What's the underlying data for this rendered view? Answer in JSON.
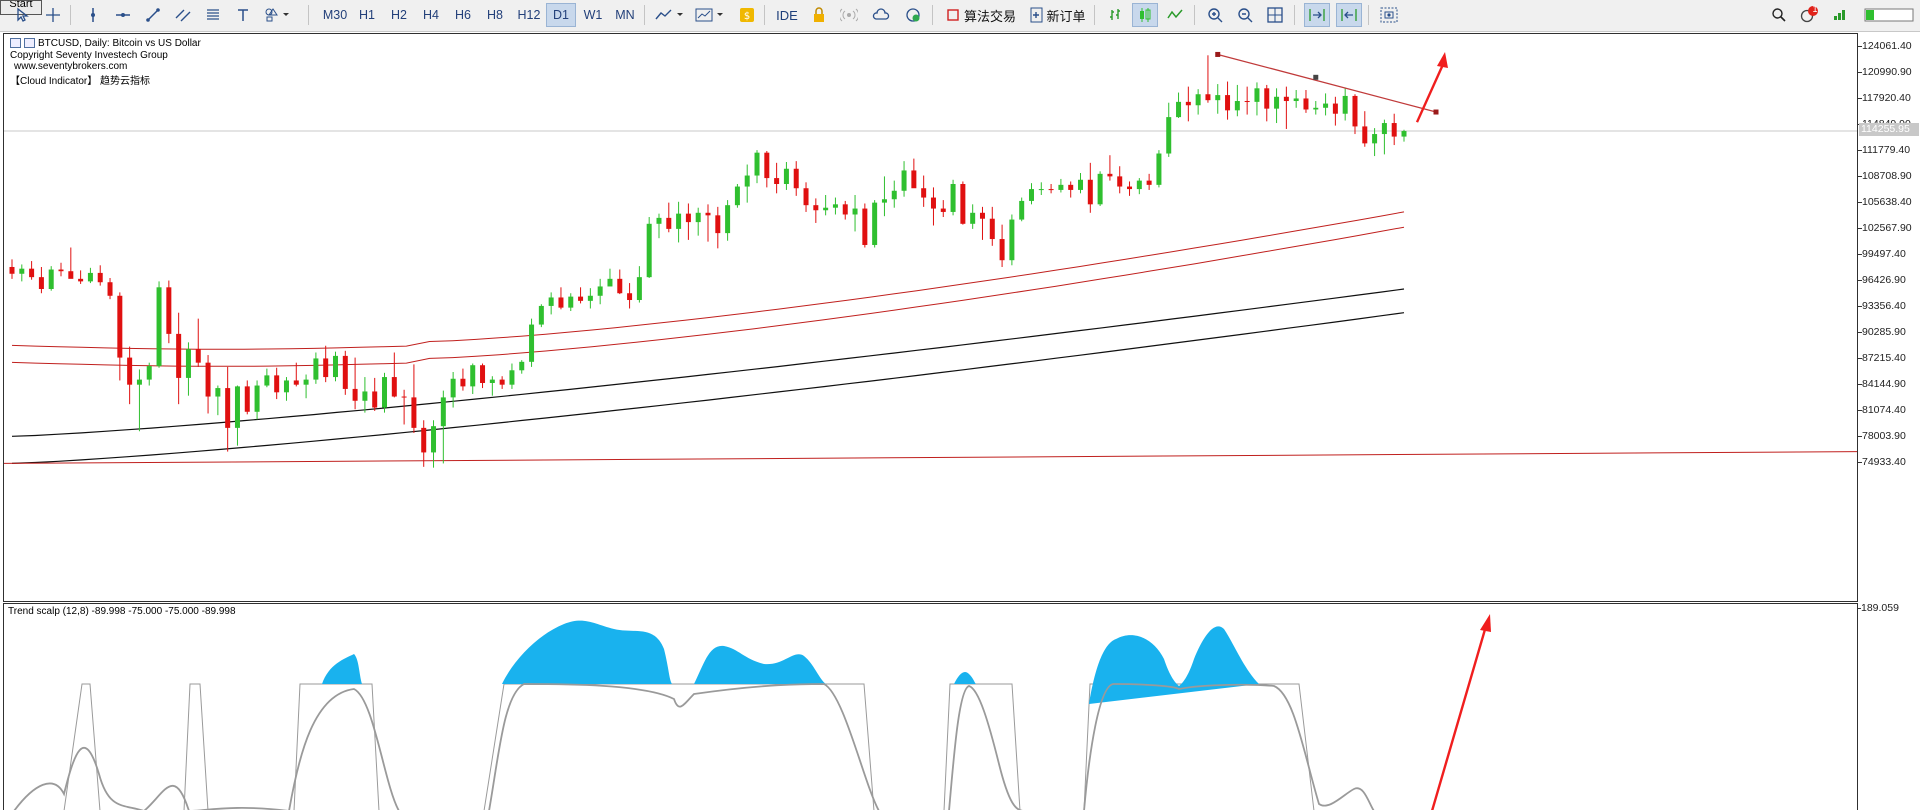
{
  "toolbar": {
    "start_label": "Start",
    "timeframes": [
      "M30",
      "H1",
      "H2",
      "H4",
      "H6",
      "H8",
      "H12",
      "D1",
      "W1",
      "MN"
    ],
    "active_timeframe": "D1",
    "ide_label": "IDE",
    "algo_trading_label": "算法交易",
    "new_order_label": "新订单",
    "notification_count": "1",
    "icons": [
      "cursor-icon",
      "crosshair-icon",
      "vertical-line-icon",
      "horizontal-line-icon",
      "trendline-icon",
      "channel-icon",
      "fibonacci-icon",
      "text-icon",
      "shapes-icon",
      "indicator-icon",
      "template-icon",
      "market-icon",
      "lock-icon",
      "signal-icon",
      "cloud-icon",
      "vps-icon",
      "algo-icon",
      "new-order-icon",
      "bar-chart-icon",
      "candle-chart-icon",
      "line-chart-icon",
      "zoom-in-icon",
      "zoom-out-icon",
      "grid-icon",
      "autoscroll-icon",
      "chart-shift-icon",
      "screenshot-icon",
      "search-icon",
      "notification-icon",
      "signal-strength-icon"
    ]
  },
  "chart": {
    "symbol_line": "BTCUSD, Daily:  Bitcoin vs US Dollar",
    "copyright": "Copyright Seventy Investech Group",
    "website": "www.seventybrokers.com",
    "indicator_name": "【Cloud Indicator】 趋势云指标",
    "price_ticks": [
      "124061.40",
      "120990.90",
      "117920.40",
      "114849.90",
      "111779.40",
      "108708.90",
      "105638.40",
      "102567.90",
      "99497.40",
      "96426.90",
      "93356.40",
      "90285.90",
      "87215.40",
      "84144.90",
      "81074.40",
      "78003.90",
      "74933.40"
    ],
    "current_price": "114255.95",
    "current_price_value": 114255.95
  },
  "indicator": {
    "label": "Trend scalp (12,8) -89.998 -75.000 -75.000 -89.998",
    "top_value": "189.059"
  },
  "colors": {
    "bull": "#2fbf2f",
    "bear": "#e01010",
    "red_band": "#c0201e",
    "black_band": "#101010",
    "cloud": "#19b2ee",
    "osc_gray": "#9a9a9a",
    "arrow": "#f01e1e",
    "toolbar_bg": "#f0f0f0"
  },
  "chart_data": {
    "type": "candlestick",
    "series_type": "ohlc",
    "price_range": [
      73500,
      125500
    ],
    "candles": [
      [
        98200,
        99100,
        96800,
        97400
      ],
      [
        97400,
        98500,
        96500,
        98000
      ],
      [
        98000,
        98900,
        96700,
        97000
      ],
      [
        97000,
        98200,
        95100,
        95600
      ],
      [
        95600,
        98300,
        95400,
        97900
      ],
      [
        97900,
        98700,
        97100,
        97700
      ],
      [
        97700,
        100500,
        97400,
        96800
      ],
      [
        96800,
        97800,
        96200,
        96500
      ],
      [
        96500,
        98100,
        96300,
        97500
      ],
      [
        97500,
        98400,
        96000,
        96400
      ],
      [
        96400,
        96900,
        94400,
        94800
      ],
      [
        94800,
        95200,
        84800,
        87500
      ],
      [
        87500,
        88800,
        82000,
        84300
      ],
      [
        84300,
        86100,
        78800,
        84900
      ],
      [
        84900,
        86900,
        84200,
        86500
      ],
      [
        86500,
        96500,
        86300,
        95800
      ],
      [
        95800,
        96600,
        89200,
        90300
      ],
      [
        90300,
        92800,
        82000,
        85100
      ],
      [
        85100,
        89300,
        83000,
        88500
      ],
      [
        88500,
        92100,
        86400,
        86900
      ],
      [
        86900,
        87800,
        80900,
        82900
      ],
      [
        82900,
        84200,
        80700,
        83900
      ],
      [
        83900,
        86400,
        76400,
        79200
      ],
      [
        79200,
        84200,
        77100,
        84100
      ],
      [
        84100,
        84800,
        80800,
        81100
      ],
      [
        81100,
        84800,
        80200,
        84200
      ],
      [
        84200,
        86200,
        84000,
        85400
      ],
      [
        85400,
        86300,
        82600,
        83400
      ],
      [
        83400,
        85200,
        82400,
        84800
      ],
      [
        84800,
        86900,
        84100,
        84300
      ],
      [
        84300,
        85500,
        82700,
        84900
      ],
      [
        84900,
        88100,
        84400,
        87400
      ],
      [
        87400,
        88900,
        84600,
        85200
      ],
      [
        85200,
        88200,
        84700,
        87700
      ],
      [
        87700,
        88300,
        83100,
        83800
      ],
      [
        83800,
        87500,
        81400,
        82400
      ],
      [
        82400,
        85200,
        81000,
        83500
      ],
      [
        83500,
        85100,
        81200,
        81600
      ],
      [
        81600,
        85700,
        81000,
        85200
      ],
      [
        85200,
        88100,
        82800,
        82900
      ],
      [
        82900,
        83700,
        79600,
        82800
      ],
      [
        82800,
        86700,
        78600,
        79200
      ],
      [
        79200,
        80100,
        74600,
        76300
      ],
      [
        76300,
        80100,
        74500,
        79400
      ],
      [
        79400,
        83600,
        75000,
        82800
      ],
      [
        82800,
        85800,
        81600,
        85000
      ],
      [
        85000,
        86200,
        83600,
        84100
      ],
      [
        84100,
        86800,
        83200,
        86600
      ],
      [
        86600,
        86800,
        83900,
        84500
      ],
      [
        84500,
        85300,
        83000,
        84900
      ],
      [
        84900,
        85300,
        83800,
        84300
      ],
      [
        84300,
        86800,
        83800,
        86000
      ],
      [
        86000,
        87200,
        85600,
        87000
      ],
      [
        87000,
        92100,
        86400,
        91400
      ],
      [
        91400,
        93800,
        91100,
        93600
      ],
      [
        93600,
        95200,
        92600,
        94600
      ],
      [
        94600,
        95800,
        93200,
        93400
      ],
      [
        93400,
        95100,
        93000,
        94700
      ],
      [
        94700,
        95800,
        93900,
        94200
      ],
      [
        94200,
        95700,
        93300,
        94800
      ],
      [
        94800,
        96800,
        93800,
        95900
      ],
      [
        95900,
        98000,
        96300,
        96800
      ],
      [
        96800,
        97900,
        95000,
        95100
      ],
      [
        95100,
        96300,
        93300,
        94300
      ],
      [
        94300,
        98300,
        94000,
        97000
      ],
      [
        97000,
        104100,
        96900,
        103300
      ],
      [
        103300,
        104500,
        101600,
        104000
      ],
      [
        104000,
        105800,
        102300,
        102700
      ],
      [
        102700,
        105900,
        101100,
        104500
      ],
      [
        104500,
        105700,
        101400,
        103500
      ],
      [
        103500,
        105200,
        101900,
        104600
      ],
      [
        104600,
        105600,
        101200,
        104300
      ],
      [
        104300,
        105300,
        100400,
        102200
      ],
      [
        102200,
        106100,
        101300,
        105500
      ],
      [
        105500,
        108000,
        105200,
        107700
      ],
      [
        107700,
        110300,
        105800,
        109000
      ],
      [
        109000,
        112000,
        108100,
        111700
      ],
      [
        111700,
        111900,
        107600,
        108700
      ],
      [
        108700,
        110500,
        106900,
        108000
      ],
      [
        108000,
        110600,
        107300,
        109800
      ],
      [
        109800,
        110700,
        106600,
        107500
      ],
      [
        107500,
        108200,
        104700,
        105500
      ],
      [
        105500,
        106300,
        103400,
        104900
      ],
      [
        104900,
        106700,
        104300,
        105200
      ],
      [
        105200,
        106400,
        104400,
        105600
      ],
      [
        105600,
        106000,
        103800,
        104400
      ],
      [
        104400,
        106700,
        102400,
        105100
      ],
      [
        105100,
        105700,
        100500,
        100800
      ],
      [
        100800,
        106100,
        100500,
        105800
      ],
      [
        105800,
        108900,
        104200,
        106200
      ],
      [
        106200,
        108400,
        105200,
        107200
      ],
      [
        107200,
        110700,
        106500,
        109600
      ],
      [
        109600,
        111000,
        107600,
        107500
      ],
      [
        107500,
        109000,
        105300,
        106400
      ],
      [
        106400,
        107600,
        103100,
        105100
      ],
      [
        105100,
        106100,
        104100,
        104700
      ],
      [
        104700,
        108500,
        104300,
        108000
      ],
      [
        108000,
        108300,
        103200,
        103300
      ],
      [
        103300,
        105600,
        102700,
        104600
      ],
      [
        104600,
        105300,
        101400,
        103900
      ],
      [
        103900,
        105300,
        100700,
        101500
      ],
      [
        101500,
        103200,
        98200,
        99000
      ],
      [
        99000,
        104400,
        98400,
        103800
      ],
      [
        103800,
        106400,
        103600,
        106000
      ],
      [
        106000,
        108100,
        105600,
        107400
      ],
      [
        107400,
        108200,
        106700,
        107400
      ],
      [
        107400,
        108000,
        106900,
        107300
      ],
      [
        107300,
        108600,
        107000,
        107900
      ],
      [
        107900,
        108300,
        106400,
        107300
      ],
      [
        107300,
        109300,
        106900,
        108500
      ],
      [
        108500,
        110500,
        104600,
        105600
      ],
      [
        105600,
        109500,
        105400,
        109200
      ],
      [
        109200,
        111400,
        108400,
        108900
      ],
      [
        108900,
        110100,
        106900,
        107700
      ],
      [
        107700,
        108300,
        106600,
        107400
      ],
      [
        107400,
        108700,
        106800,
        108400
      ],
      [
        108400,
        109200,
        107300,
        107900
      ],
      [
        107900,
        112000,
        107600,
        111600
      ],
      [
        111600,
        117600,
        111200,
        115900
      ],
      [
        115900,
        118800,
        115800,
        117700
      ],
      [
        117700,
        119500,
        115400,
        117300
      ],
      [
        117300,
        119200,
        116200,
        118600
      ],
      [
        118600,
        123200,
        117600,
        117900
      ],
      [
        117900,
        119800,
        116300,
        118500
      ],
      [
        118500,
        120100,
        115600,
        116700
      ],
      [
        116700,
        119700,
        116000,
        117800
      ],
      [
        117800,
        119500,
        116200,
        117700
      ],
      [
        117700,
        120000,
        116100,
        119300
      ],
      [
        119300,
        119700,
        115400,
        116900
      ],
      [
        116900,
        119300,
        115200,
        118300
      ],
      [
        118300,
        119500,
        114500,
        117800
      ],
      [
        117800,
        119100,
        117000,
        118100
      ],
      [
        118100,
        119100,
        116400,
        116800
      ],
      [
        116800,
        117800,
        116200,
        117000
      ],
      [
        117000,
        118700,
        116100,
        117500
      ],
      [
        117500,
        118300,
        114900,
        116300
      ],
      [
        116300,
        119400,
        115500,
        118400
      ],
      [
        118400,
        118600,
        113900,
        114800
      ],
      [
        114800,
        116600,
        112400,
        112800
      ],
      [
        112800,
        114600,
        111300,
        113900
      ],
      [
        113900,
        115600,
        111500,
        115200
      ],
      [
        115200,
        116300,
        112600,
        113600
      ],
      [
        113600,
        114400,
        113000,
        114255
      ]
    ],
    "bands": {
      "red_upper_start": 89400,
      "red_upper_end": 104700,
      "red_lower_start": 87400,
      "red_lower_end": 102900,
      "black_upper_start": 78200,
      "black_upper_end": 95600,
      "black_lower_start": 75000,
      "black_lower_end": 92800,
      "red_flat_start": 75000,
      "red_flat_end": 76400
    },
    "trendline": {
      "from": [
        123300
      ],
      "to": [
        116500
      ]
    },
    "indicator_top": 189.059
  }
}
